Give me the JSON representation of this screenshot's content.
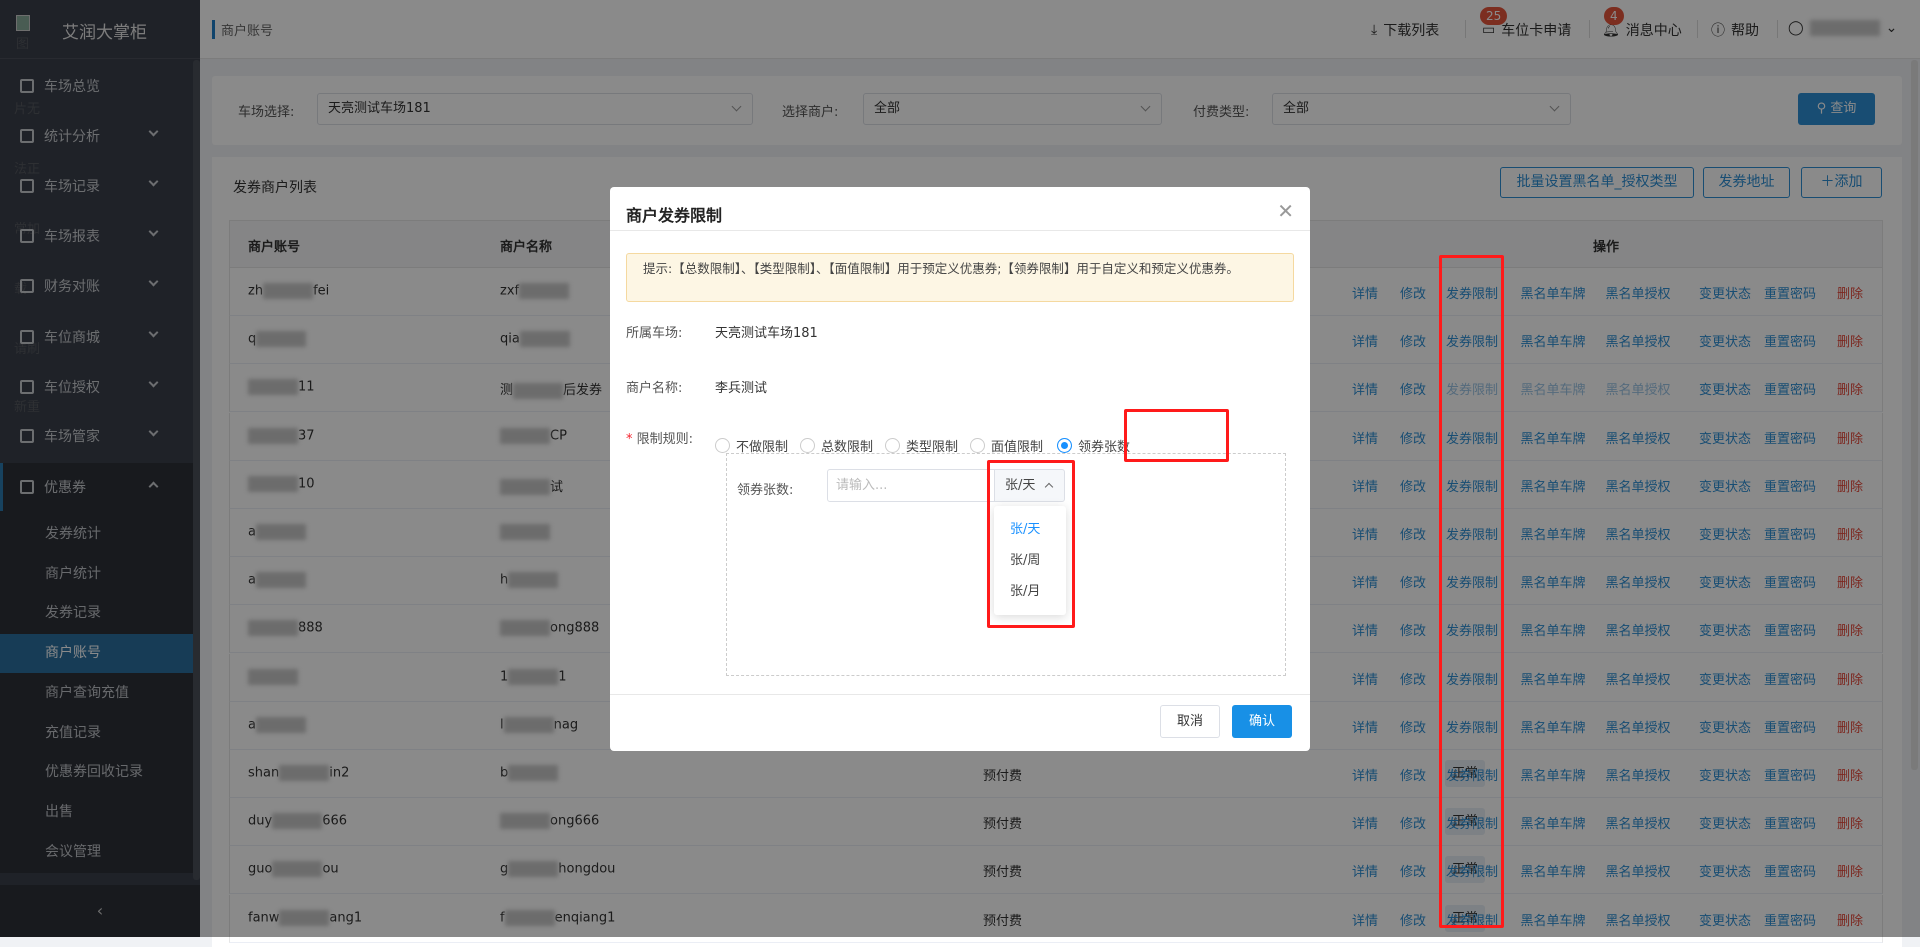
{
  "app": {
    "title": "艾润大掌柜",
    "broken_image_alt": [
      "图",
      "片无",
      "法正",
      "常加",
      "载",
      "请刷",
      "新重",
      "试"
    ]
  },
  "sidebar": {
    "items": [
      {
        "label": "车场总览"
      },
      {
        "label": "统计分析"
      },
      {
        "label": "车场记录"
      },
      {
        "label": "车场报表"
      },
      {
        "label": "财务对账"
      },
      {
        "label": "车位商城"
      },
      {
        "label": "车位授权"
      },
      {
        "label": "车场管家"
      }
    ],
    "coupon": {
      "label": "优惠券",
      "children": [
        "发券统计",
        "商户统计",
        "发券记录",
        "商户账号",
        "商户查询充值",
        "充值记录",
        "优惠券回收记录",
        "出售",
        "会议管理"
      ],
      "active": "商户账号"
    },
    "collapse_icon": "chevron-left"
  },
  "header": {
    "breadcrumb": "商户账号",
    "download": "下载列表",
    "card_apply": "车位卡申请",
    "card_badge": "25",
    "messages": "消息中心",
    "msg_badge": "4",
    "help": "帮助"
  },
  "filter": {
    "lot_label": "车场选择:",
    "lot_value": "天亮测试车场181",
    "merchant_label": "选择商户:",
    "merchant_value": "全部",
    "pay_label": "付费类型:",
    "pay_value": "全部",
    "query": "查询"
  },
  "list": {
    "title": "发券商户列表",
    "batch_btn": "批量设置黑名单_授权类型",
    "address_btn": "发券地址",
    "add_btn": "添加",
    "headers": {
      "account": "商户账号",
      "name": "商户名称",
      "ops": "操作"
    },
    "ops": [
      "详情",
      "修改",
      "发券限制",
      "黑名单车牌",
      "黑名单授权",
      "变更状态",
      "重置密码",
      "删除"
    ],
    "rows": [
      {
        "acc": [
          "zh",
          "fei"
        ],
        "name": [
          "zxf",
          ""
        ]
      },
      {
        "acc": [
          "q",
          ""
        ],
        "name": [
          "qia",
          ""
        ]
      },
      {
        "acc": [
          "",
          "11"
        ],
        "name": [
          "测",
          "后发券"
        ],
        "disabled": true
      },
      {
        "acc": [
          "",
          "37"
        ],
        "name": [
          "",
          "CP"
        ]
      },
      {
        "acc": [
          "",
          "10"
        ],
        "name": [
          "",
          "试"
        ]
      },
      {
        "acc": [
          "a",
          ""
        ],
        "name": [
          "",
          ""
        ]
      },
      {
        "acc": [
          "a",
          ""
        ],
        "name": [
          "h",
          ""
        ]
      },
      {
        "acc": [
          "",
          "888"
        ],
        "name": [
          "",
          "ong888"
        ]
      },
      {
        "acc": [
          "",
          ""
        ],
        "name": [
          "1",
          "1"
        ]
      },
      {
        "acc": [
          "a",
          ""
        ],
        "name": [
          "l",
          "nag"
        ]
      },
      {
        "acc": [
          "shan",
          "in2"
        ],
        "name": [
          "b",
          ""
        ],
        "pay": "预付费",
        "status": "正常"
      },
      {
        "acc": [
          "duy",
          "666"
        ],
        "name": [
          "",
          "ong666"
        ],
        "pay": "预付费",
        "status": "正常"
      },
      {
        "acc": [
          "guo",
          "ou"
        ],
        "name": [
          "g",
          "hongdou"
        ],
        "pay": "预付费",
        "status": "正常"
      },
      {
        "acc": [
          "fanw",
          "ang1"
        ],
        "name": [
          "f",
          "enqiang1"
        ],
        "pay": "预付费",
        "status": "正常"
      }
    ]
  },
  "modal": {
    "title": "商户发券限制",
    "hint": "提示:【总数限制】、【类型限制】、【面值限制】用于预定义优惠券;【领券限制】用于自定义和预定义优惠券。",
    "lot_label": "所属车场:",
    "lot_value": "天亮测试车场181",
    "name_label": "商户名称:",
    "name_value": "李兵测试",
    "rule_label": "限制规则:",
    "rules": [
      "不做限制",
      "总数限制",
      "类型限制",
      "面值限制",
      "领券张数"
    ],
    "selected_rule": "领券张数",
    "count_label": "领券张数:",
    "count_placeholder": "请输入...",
    "unit_value": "张/天",
    "unit_options": [
      "张/天",
      "张/周",
      "张/月"
    ],
    "cancel": "取消",
    "confirm": "确认"
  },
  "colors": {
    "primary": "#1890e6",
    "danger": "#e64a3c",
    "annotation": "#ff1a1a"
  }
}
